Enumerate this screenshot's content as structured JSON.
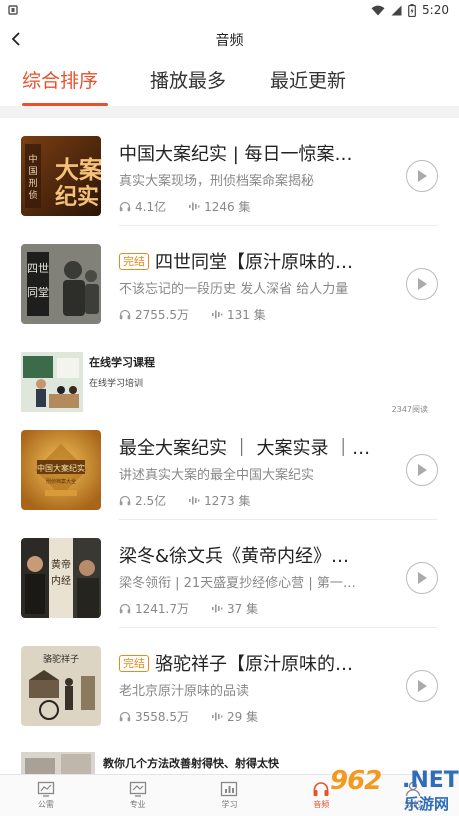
{
  "status_bar": {
    "time": "5:20"
  },
  "nav": {
    "title": "音频"
  },
  "tabs": [
    {
      "label": "综合排序",
      "active": true
    },
    {
      "label": "播放最多",
      "active": false
    },
    {
      "label": "最近更新",
      "active": false
    }
  ],
  "items": [
    {
      "title": "中国大案纪实 | 每日一惊案…",
      "badge": "",
      "desc": "真实大案现场，刑侦档案命案揭秘",
      "plays": "4.1亿",
      "episodes": "1246 集",
      "cover_text": "中国刑侦 大案纪实"
    },
    {
      "title": "四世同堂【原汁原味的…",
      "badge": "完结",
      "desc": "不该忘记的一段历史 发人深省 给人力量",
      "plays": "2755.5万",
      "episodes": "131 集",
      "cover_text": "四世同堂"
    },
    {
      "title": "最全大案纪实 ｜ 大案实录 ｜…",
      "badge": "",
      "desc": "讲述真实大案的最全中国大案纪实",
      "plays": "2.5亿",
      "episodes": "1273 集",
      "cover_text": "中国大案纪实"
    },
    {
      "title": "梁冬&徐文兵《黄帝内经》…",
      "badge": "",
      "desc": "梁冬领衔 | 21天盛夏抄经修心营 | 第一…",
      "plays": "1241.7万",
      "episodes": "37 集",
      "cover_text": "黄帝内经"
    },
    {
      "title": "骆驼祥子【原汁原味的…",
      "badge": "完结",
      "desc": "老北京原汁原味的品读",
      "plays": "3558.5万",
      "episodes": "29 集",
      "cover_text": "骆驼祥子"
    }
  ],
  "ad": {
    "title": "在线学习课程",
    "subtitle": "在线学习培训",
    "reads": "2347阅读"
  },
  "ad2": {
    "title": "教你几个方法改善射得快、射得太快"
  },
  "bottom_nav": [
    {
      "label": "公需",
      "icon": "chart-board-icon",
      "active": false
    },
    {
      "label": "专业",
      "icon": "trend-board-icon",
      "active": false
    },
    {
      "label": "学习",
      "icon": "bar-chart-icon",
      "active": false
    },
    {
      "label": "音频",
      "icon": "headphones-icon",
      "active": true
    },
    {
      "label": "我的",
      "icon": "person-icon",
      "active": false
    }
  ],
  "watermark": {
    "number": "962",
    "domain": ".NET",
    "site": "乐游网"
  },
  "colors": {
    "accent": "#e8512c",
    "badge": "#e8891c"
  }
}
